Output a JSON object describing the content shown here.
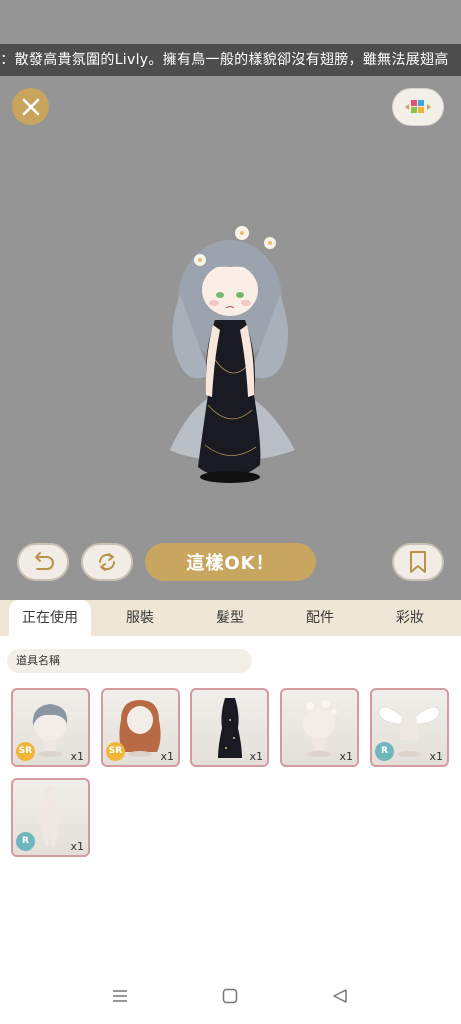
{
  "marquee": {
    "text": "八：散發高貴氛圍的Livly。擁有鳥一般的樣貌卻沒有翅膀，雖無法展翅高"
  },
  "icons": {
    "close": "close-icon",
    "palette": "color-palette-icon",
    "undo": "undo-icon",
    "redo": "redo-icon",
    "bookmark": "bookmark-icon"
  },
  "actions": {
    "ok_label": "這樣OK！"
  },
  "tabs": [
    {
      "label": "正在使用",
      "active": true
    },
    {
      "label": "服裝"
    },
    {
      "label": "髮型"
    },
    {
      "label": "配件"
    },
    {
      "label": "彩妝"
    }
  ],
  "item_name_placeholder": "道具名稱",
  "items": [
    {
      "name": "gray-hair",
      "rarity": "SR",
      "qty": "x1"
    },
    {
      "name": "auburn-hair",
      "rarity": "SR",
      "qty": "x1"
    },
    {
      "name": "black-dress",
      "rarity": "",
      "qty": "x1"
    },
    {
      "name": "flower-crown",
      "rarity": "",
      "qty": "x1"
    },
    {
      "name": "angel-wings",
      "rarity": "R",
      "qty": "x1"
    },
    {
      "name": "body-base",
      "rarity": "R",
      "qty": "x1"
    }
  ],
  "colors": {
    "accent": "#c8a660",
    "stage_bg": "#959595",
    "tab_bg": "#efe6d6",
    "item_border": "#d59aa0"
  }
}
